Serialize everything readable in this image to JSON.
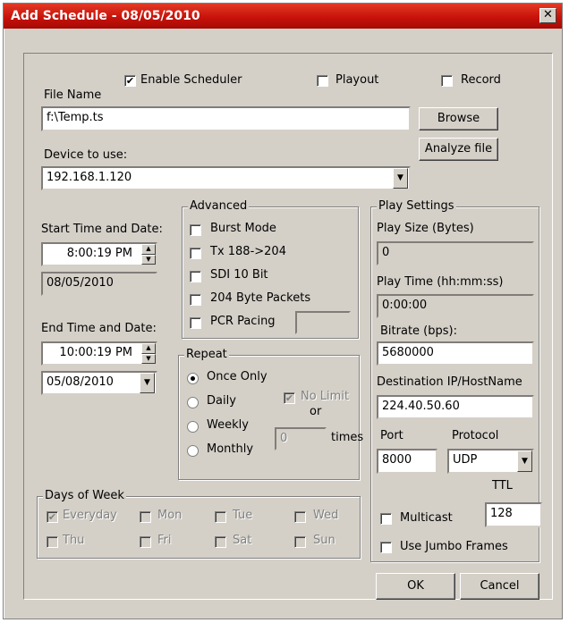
{
  "window": {
    "title": "Add Schedule - 08/05/2010",
    "close_glyph": "✕"
  },
  "top": {
    "enable_scheduler": {
      "label": "Enable Scheduler",
      "checked": true
    },
    "playout": {
      "label": "Playout",
      "checked": false
    },
    "record": {
      "label": "Record",
      "checked": false
    }
  },
  "file": {
    "label": "File Name",
    "value": "f:\\Temp.ts",
    "browse_label": "Browse",
    "analyze_label": "Analyze file"
  },
  "device": {
    "label": "Device to use:",
    "value": "192.168.1.120"
  },
  "start": {
    "label": "Start Time and Date:",
    "time": "8:00:19 PM",
    "date": "08/05/2010"
  },
  "end": {
    "label": "End Time and Date:",
    "time": "10:00:19 PM",
    "date": "05/08/2010"
  },
  "advanced": {
    "title": "Advanced",
    "items": [
      "Burst Mode",
      "Tx 188->204",
      "SDI 10 Bit",
      "204 Byte Packets",
      "PCR Pacing"
    ]
  },
  "repeat": {
    "title": "Repeat",
    "options": [
      "Once Only",
      "Daily",
      "Weekly",
      "Monthly"
    ],
    "selected": "Once Only",
    "no_limit_label": "No Limit",
    "or_label": "or",
    "times_value": "0",
    "times_label": "times"
  },
  "days": {
    "title": "Days of Week",
    "items": [
      "Everyday",
      "Mon",
      "Tue",
      "Wed",
      "Thu",
      "Fri",
      "Sat",
      "Sun"
    ]
  },
  "play": {
    "title": "Play Settings",
    "size_label": "Play Size (Bytes)",
    "size_value": "0",
    "time_label": "Play Time (hh:mm:ss)",
    "time_value": "0:00:00",
    "bitrate_label": "Bitrate (bps):",
    "bitrate_value": "5680000",
    "dest_label": "Destination IP/HostName",
    "dest_value": "224.40.50.60",
    "port_label": "Port",
    "port_value": "8000",
    "protocol_label": "Protocol",
    "protocol_value": "UDP",
    "ttl_label": "TTL",
    "ttl_value": "128",
    "multicast_label": "Multicast",
    "jumbo_label": "Use Jumbo Frames"
  },
  "footer": {
    "ok_label": "OK",
    "cancel_label": "Cancel"
  },
  "colors": {
    "title_bar": "#c8120a",
    "face": "#d4d0c8"
  }
}
